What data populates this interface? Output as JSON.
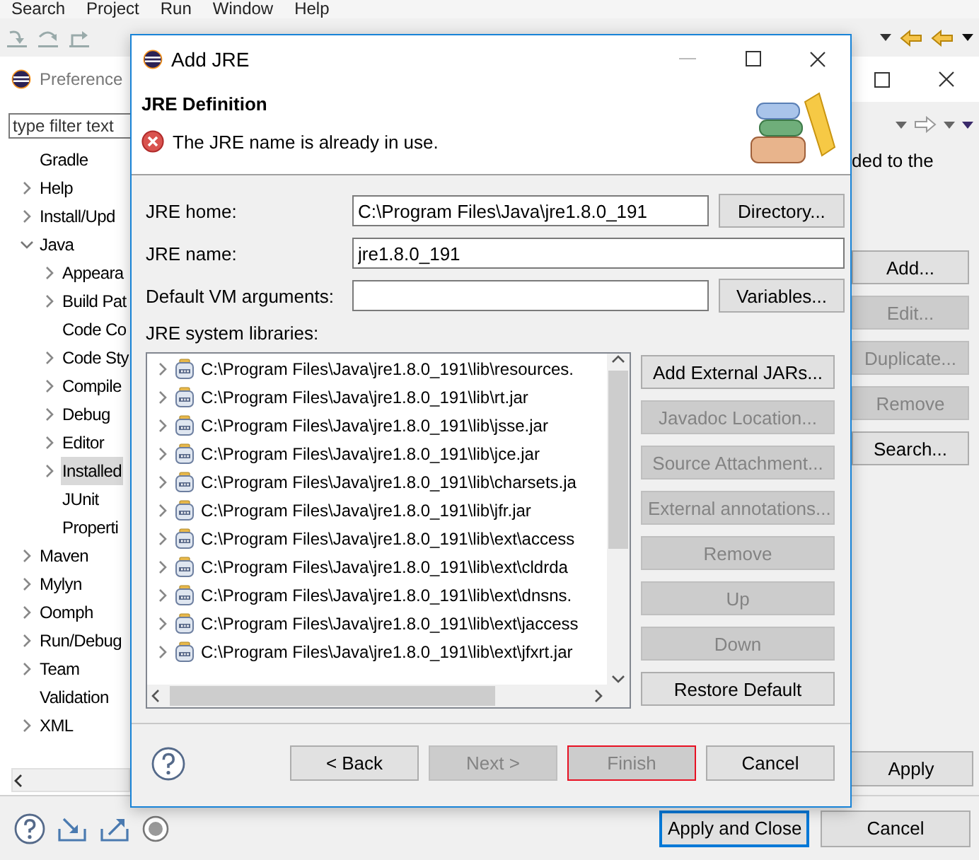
{
  "menu_bar": [
    "Search",
    "Project",
    "Run",
    "Window",
    "Help"
  ],
  "preferences": {
    "title": "Preference",
    "filter": {
      "placeholder": "type filter text"
    },
    "tree": [
      {
        "label": "Gradle",
        "selected": false
      },
      {
        "label": "Help",
        "expanded": false,
        "selected": false
      },
      {
        "label": "Install/Upd",
        "expanded": false,
        "selected": false
      },
      {
        "label": "Java",
        "expanded": true,
        "selected": false,
        "children": [
          {
            "label": "Appeara",
            "expanded": false,
            "selected": false
          },
          {
            "label": "Build Pat",
            "expanded": false,
            "selected": false
          },
          {
            "label": "Code Co",
            "selected": false
          },
          {
            "label": "Code Sty",
            "expanded": false,
            "selected": false
          },
          {
            "label": "Compile",
            "expanded": false,
            "selected": false
          },
          {
            "label": "Debug",
            "expanded": false,
            "selected": false
          },
          {
            "label": "Editor",
            "expanded": false,
            "selected": false
          },
          {
            "label": "Installed",
            "expanded": false,
            "selected": true
          },
          {
            "label": "JUnit",
            "selected": false
          },
          {
            "label": "Properti",
            "selected": false
          }
        ]
      },
      {
        "label": "Maven",
        "expanded": false,
        "selected": false
      },
      {
        "label": "Mylyn",
        "expanded": false,
        "selected": false
      },
      {
        "label": "Oomph",
        "expanded": false,
        "selected": false
      },
      {
        "label": "Run/Debug",
        "expanded": false,
        "selected": false
      },
      {
        "label": "Team",
        "expanded": false,
        "selected": false
      },
      {
        "label": "Validation",
        "selected": false
      },
      {
        "label": "XML",
        "expanded": false,
        "selected": false
      }
    ],
    "description": "ded to the",
    "buttons": [
      {
        "label": "Add...",
        "disabled": false
      },
      {
        "label": "Edit...",
        "disabled": true
      },
      {
        "label": "Duplicate...",
        "disabled": true
      },
      {
        "label": "Remove",
        "disabled": true
      },
      {
        "label": "Search...",
        "disabled": false
      }
    ],
    "apply_button": "Apply",
    "footer_buttons": [
      {
        "label": "Apply and Close",
        "default": true
      },
      {
        "label": "Cancel",
        "default": false
      }
    ]
  },
  "dialog": {
    "title": "Add JRE",
    "heading": "JRE Definition",
    "message": {
      "kind": "error",
      "text": "The JRE name is already in use."
    },
    "fields": [
      {
        "label": "JRE home:",
        "value": "C:\\Program Files\\Java\\jre1.8.0_191",
        "button": "Directory..."
      },
      {
        "label": "JRE name:",
        "value": "jre1.8.0_191"
      },
      {
        "label": "Default VM arguments:",
        "button": "Variables..."
      }
    ],
    "libraries_label": "JRE system libraries:",
    "libraries": [
      {
        "path": "C:\\Program Files\\Java\\jre1.8.0_191\\lib\\resources.",
        "expanded": false
      },
      {
        "path": "C:\\Program Files\\Java\\jre1.8.0_191\\lib\\rt.jar",
        "expanded": false
      },
      {
        "path": "C:\\Program Files\\Java\\jre1.8.0_191\\lib\\jsse.jar",
        "expanded": false
      },
      {
        "path": "C:\\Program Files\\Java\\jre1.8.0_191\\lib\\jce.jar",
        "expanded": false
      },
      {
        "path": "C:\\Program Files\\Java\\jre1.8.0_191\\lib\\charsets.ja",
        "expanded": false
      },
      {
        "path": "C:\\Program Files\\Java\\jre1.8.0_191\\lib\\jfr.jar",
        "expanded": false
      },
      {
        "path": "C:\\Program Files\\Java\\jre1.8.0_191\\lib\\ext\\access",
        "expanded": false
      },
      {
        "path": "C:\\Program Files\\Java\\jre1.8.0_191\\lib\\ext\\cldrda",
        "expanded": false
      },
      {
        "path": "C:\\Program Files\\Java\\jre1.8.0_191\\lib\\ext\\dnsns.",
        "expanded": false
      },
      {
        "path": "C:\\Program Files\\Java\\jre1.8.0_191\\lib\\ext\\jaccess",
        "expanded": false
      },
      {
        "path": "C:\\Program Files\\Java\\jre1.8.0_191\\lib\\ext\\jfxrt.jar",
        "expanded": false
      }
    ],
    "library_buttons": [
      {
        "label": "Add External JARs...",
        "disabled": false
      },
      {
        "label": "Javadoc Location...",
        "disabled": true
      },
      {
        "label": "Source Attachment...",
        "disabled": true
      },
      {
        "label": "External annotations...",
        "disabled": true
      },
      {
        "label": "Remove",
        "disabled": true
      },
      {
        "label": "Up",
        "disabled": true
      },
      {
        "label": "Down",
        "disabled": true
      },
      {
        "label": "Restore Default",
        "disabled": false
      }
    ],
    "nav_buttons": [
      {
        "label": "< Back",
        "disabled": false,
        "highlighted": false
      },
      {
        "label": "Next >",
        "disabled": true,
        "highlighted": false
      },
      {
        "label": "Finish",
        "disabled": true,
        "highlighted": true
      },
      {
        "label": "Cancel",
        "disabled": false,
        "highlighted": false
      }
    ]
  }
}
